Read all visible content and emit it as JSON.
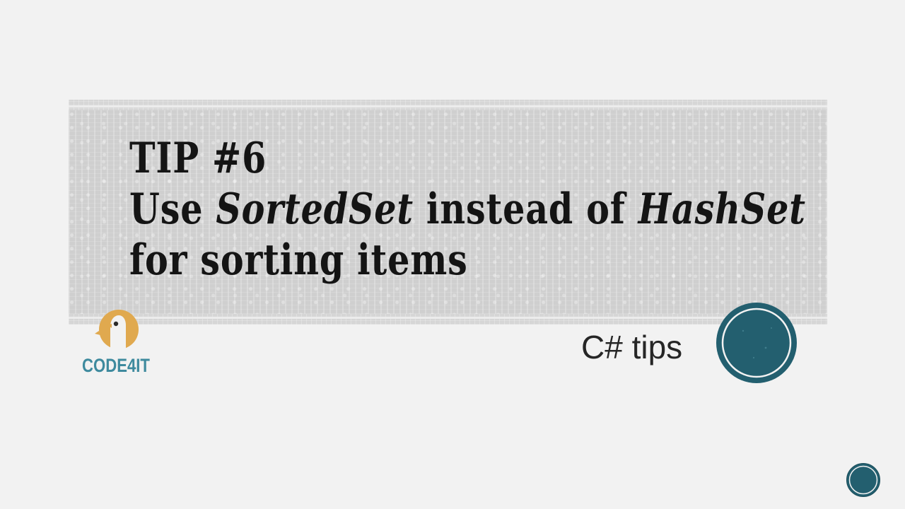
{
  "slide": {
    "title_line1": "TIP #6",
    "title_line2_pre": "Use ",
    "title_line2_em1": "SortedSet",
    "title_line2_mid": " instead of ",
    "title_line2_em2": "HashSet",
    "title_line3": "for sorting items",
    "subtitle": "C# tips"
  },
  "logo": {
    "text": "CODE4IT",
    "text_color": "#3e8a9e",
    "mark_color": "#e0a94f"
  },
  "accent_color": "#235f6f",
  "icons": {
    "decor_circle": "teal-ring-circle",
    "nav_button": "teal-circle-nav"
  }
}
